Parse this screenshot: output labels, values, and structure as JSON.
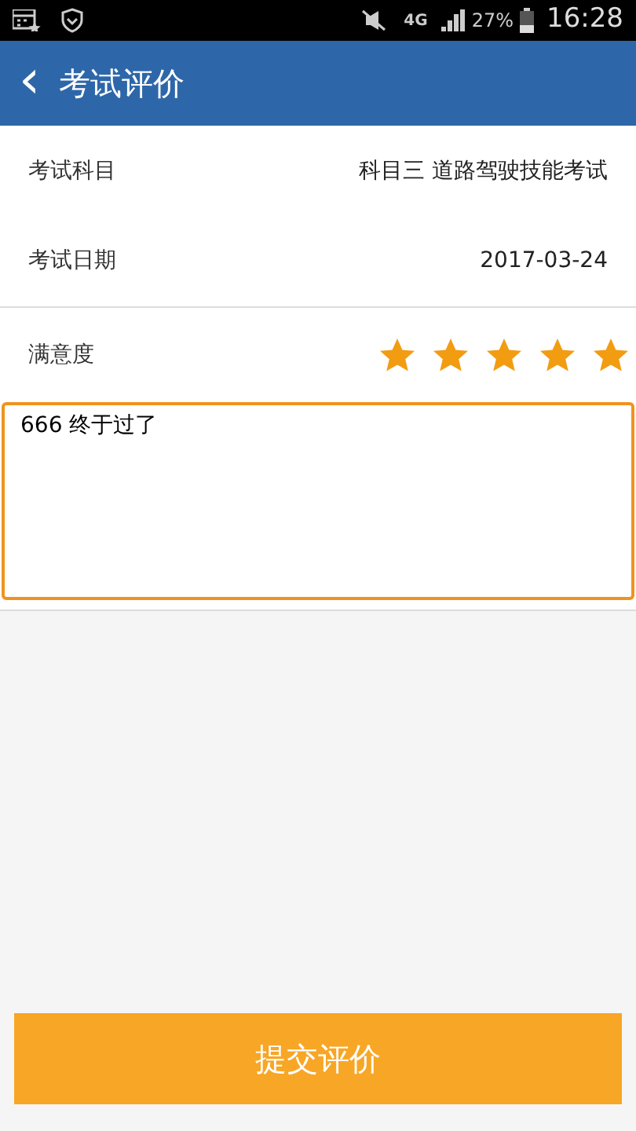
{
  "status_bar": {
    "network": "4G",
    "battery": "27%",
    "time": "16:28"
  },
  "header": {
    "back": "‹",
    "title": "考试评价"
  },
  "fields": [
    {
      "label": "考试科目",
      "value": "科目三 道路驾驶技能考试"
    },
    {
      "label": "考试日期",
      "value": "2017-03-24"
    }
  ],
  "rating": {
    "label": "满意度",
    "stars": 5
  },
  "comment": {
    "value": "666 终于过了"
  },
  "submit": {
    "label": "提交评价"
  }
}
